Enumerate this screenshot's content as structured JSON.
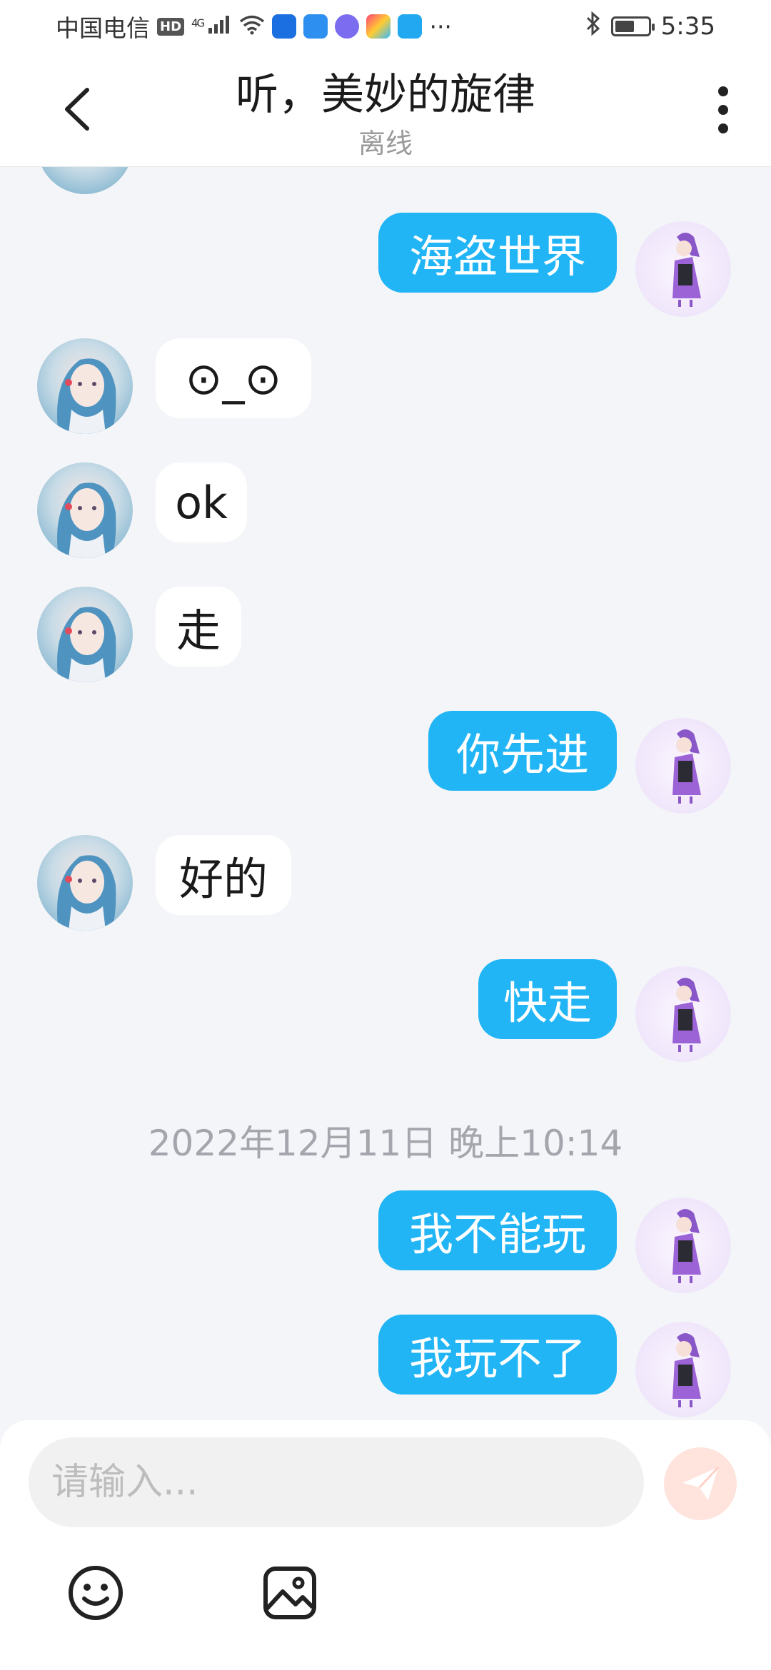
{
  "status_bar": {
    "carrier": "中国电信",
    "hd_badge": "HD",
    "network": "4G",
    "more_indicator": "···",
    "time": "5:35",
    "battery_level": 0.6,
    "icons": [
      "hd-icon",
      "signal-icon",
      "wifi-icon",
      "app-icon",
      "weather-icon",
      "music-icon",
      "app-icon",
      "search-app-icon",
      "bluetooth-icon",
      "battery-icon"
    ]
  },
  "header": {
    "title": "听，美妙的旋律",
    "subtitle": "离线",
    "back_icon": "chevron-left-icon",
    "more_icon": "more-vertical-icon"
  },
  "messages": [
    {
      "from": "peer",
      "text": "⊙_⊙"
    },
    {
      "from": "peer",
      "text": "ok"
    },
    {
      "from": "peer",
      "text": "走"
    },
    {
      "from": "me",
      "text": "海盗世界"
    },
    {
      "from": "me",
      "text": "你先进"
    },
    {
      "from": "peer",
      "text": "好的"
    },
    {
      "from": "me",
      "text": "快走"
    },
    {
      "from": "me",
      "text": "我不能玩"
    },
    {
      "from": "me",
      "text": "我玩不了"
    }
  ],
  "timestamp": "2022年12月11日 晚上10:14",
  "input": {
    "placeholder": "请输入...",
    "value": ""
  },
  "toolbar": {
    "send_icon": "send-icon",
    "emoji_icon": "emoji-icon",
    "image_icon": "image-icon"
  },
  "colors": {
    "my_bubble": "#21b5f5",
    "peer_bubble": "#ffffff",
    "background": "#f4f5f8",
    "send_button": "#ffe4de"
  }
}
